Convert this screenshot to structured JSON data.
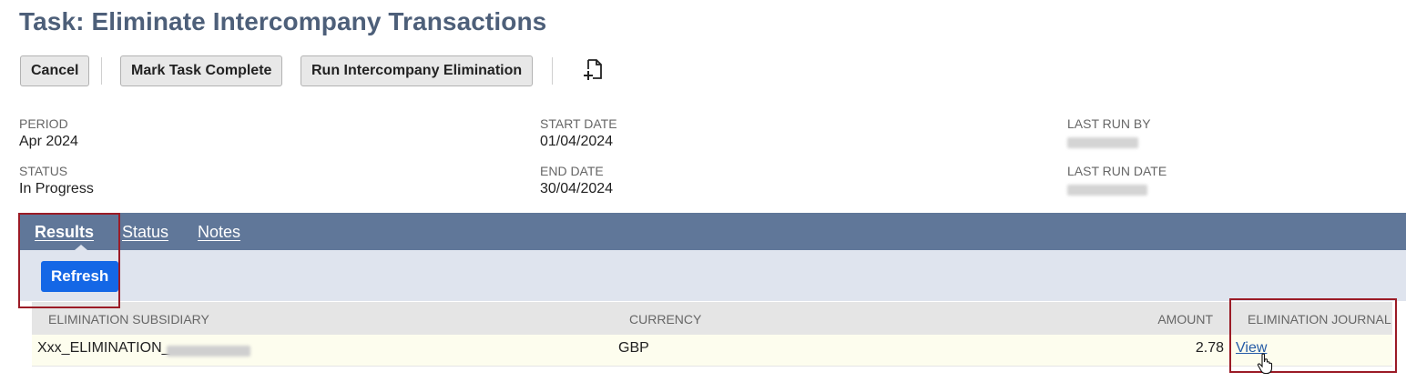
{
  "page": {
    "title": "Task: Eliminate Intercompany Transactions"
  },
  "toolbar": {
    "cancel_label": "Cancel",
    "mark_complete_label": "Mark Task Complete",
    "run_elimination_label": "Run Intercompany Elimination",
    "attach_icon": "document-add-icon"
  },
  "fields": {
    "period": {
      "label": "PERIOD",
      "value": "Apr 2024"
    },
    "status": {
      "label": "STATUS",
      "value": "In Progress"
    },
    "start_date": {
      "label": "START DATE",
      "value": "01/04/2024"
    },
    "end_date": {
      "label": "END DATE",
      "value": "30/04/2024"
    },
    "last_run_by": {
      "label": "LAST RUN BY"
    },
    "last_run_date": {
      "label": "LAST RUN DATE"
    }
  },
  "tabs": [
    {
      "label": "Results",
      "active": true
    },
    {
      "label": "Status",
      "active": false
    },
    {
      "label": "Notes",
      "active": false
    }
  ],
  "results": {
    "refresh_label": "Refresh",
    "columns": [
      "ELIMINATION SUBSIDIARY",
      "CURRENCY",
      "AMOUNT",
      "ELIMINATION JOURNAL"
    ],
    "rows": [
      {
        "subsidiary": "Xxx_ELIMINATION_",
        "currency": "GBP",
        "amount": "2.78",
        "journal": "View"
      }
    ]
  },
  "colors": {
    "title": "#4d5f79",
    "tabbar": "#607799",
    "subtab_area": "#dfe4ee",
    "primary_button": "#1467e6",
    "highlight_border": "#9b1b26",
    "link": "#255ba6"
  }
}
